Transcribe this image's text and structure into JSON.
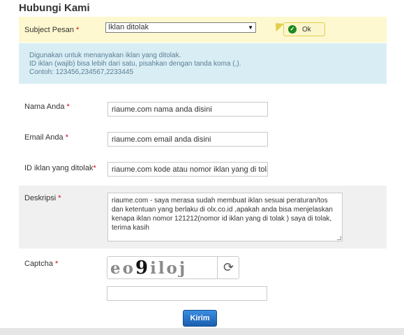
{
  "page": {
    "title": "Hubungi Kami"
  },
  "subject": {
    "label": "Subject Pesan",
    "required_mark": "*",
    "selected": "Iklan ditolak",
    "status_label": "Ok"
  },
  "info": {
    "lines": [
      "Digunakan untuk menanyakan iklan yang ditolak.",
      "ID iklan (wajib) bisa lebih dari satu, pisahkan dengan tanda koma (,).",
      "Contoh: 123456,234567,2233445"
    ]
  },
  "fields": {
    "name": {
      "label": "Nama Anda",
      "required_mark": "*",
      "value": "riaume.com nama anda disini"
    },
    "email": {
      "label": "Email Anda",
      "required_mark": "*",
      "value": "riaume.com  email anda disini"
    },
    "ad_id": {
      "label": "ID iklan yang ditolak",
      "required_mark": "*",
      "value": "riaume.com  kode atau nomor iklan yang di tolak"
    },
    "description": {
      "label": "Deskripsi",
      "required_mark": "*",
      "lines": [
        "riaume.com - saya merasa sudah membuat iklan sesuai peraturan/tos",
        "dan ketentuan yang berlaku di olx.co.id ,apakah anda bisa menjelaskan",
        "kenapa iklan nomor 121212(nomor id iklan yang di tolak ) saya di tolak,",
        "terima kasih"
      ]
    },
    "captcha": {
      "label": "Captcha",
      "required_mark": "*",
      "text_a": "eo",
      "text_b": "9",
      "text_c": "iloj",
      "value": ""
    }
  },
  "actions": {
    "submit_label": "Kirim"
  },
  "colors": {
    "subject_bg": "#fdf8cf",
    "info_bg": "#d9edf4",
    "desc_bg": "#f0f0f0",
    "required": "#d9001a",
    "ok_check": "#1e8a1e",
    "submit": "#1a5fb0"
  },
  "icons": {
    "ok": "check-circle-icon",
    "refresh": "refresh-icon",
    "select_arrow": "caret-down-icon"
  }
}
